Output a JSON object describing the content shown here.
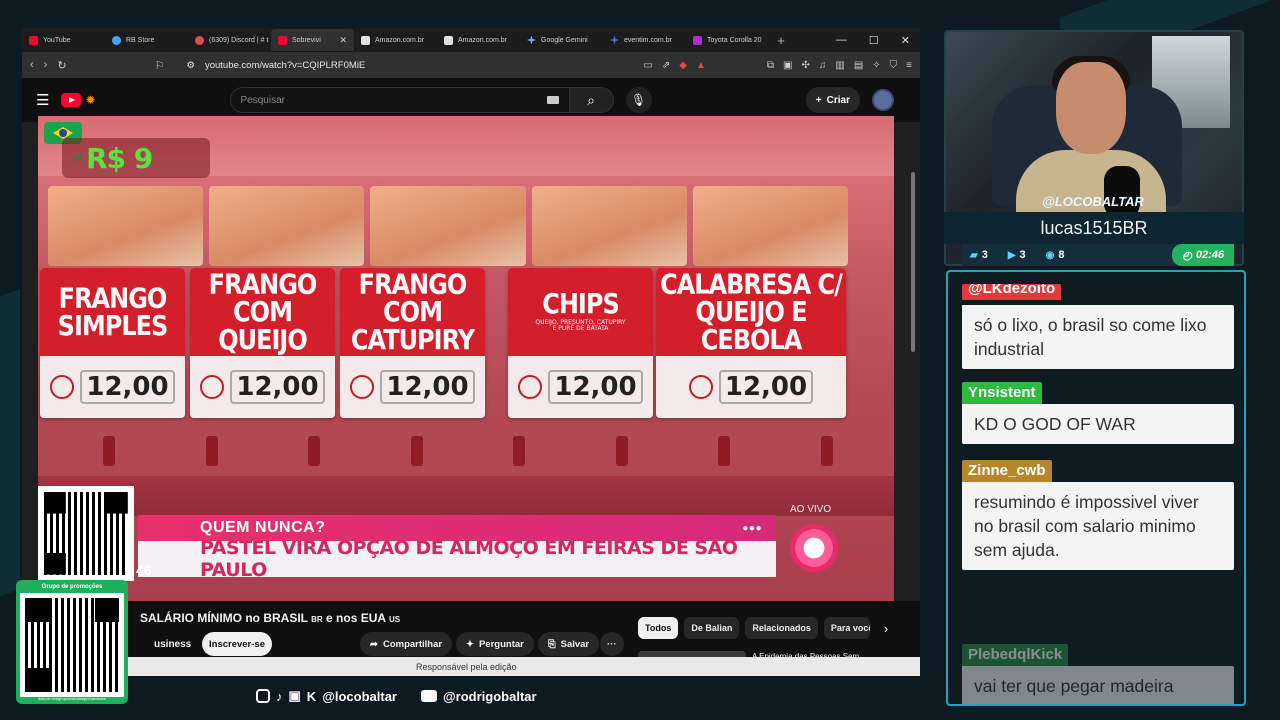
{
  "browser": {
    "tabs": [
      {
        "label": "YouTube",
        "color": "#ff0033"
      },
      {
        "label": "RB Store",
        "color": "#3da9f5"
      },
      {
        "label": "(6309) Discord | # t",
        "color": "#e14b52"
      },
      {
        "label": "Sobrevivi",
        "color": "#ff0033",
        "active": true
      },
      {
        "label": "Amazon.com.br",
        "color": "#e0e0e0"
      },
      {
        "label": "Amazon.com.br",
        "color": "#e0e0e0"
      },
      {
        "label": "Google Gemini",
        "color": "#7aa2ff"
      },
      {
        "label": "eventim.com.br",
        "color": "#5562e5"
      },
      {
        "label": "Toyota Corolla 20",
        "color": "#b12bd6"
      }
    ],
    "url": "youtube.com/watch?v=CQIPLRF0MiE"
  },
  "youtube": {
    "search_placeholder": "Pesquisar",
    "create_label": "Criar"
  },
  "video": {
    "price_tag_small": "MÍ",
    "price_tag": "R$ 9",
    "signs": [
      {
        "name": "FRANGO\nSIMPLES",
        "price": "12,00"
      },
      {
        "name": "FRANGO\nCOM QUEIJO",
        "price": "12,00"
      },
      {
        "name": "FRANGO COM\nCATUPIRY",
        "price": "12,00"
      },
      {
        "name": "CHIPS",
        "sub": "QUEIJO, PRESUNTO, CATUPIRY\nE PURÊ DE BATATA",
        "price": "12,00"
      },
      {
        "name": "CALABRESA C/\nQUEIJO E CEBOLA",
        "price": "12,00"
      }
    ],
    "news_top": "QUEM NUNCA?",
    "news_bottom": "PASTEL VIRA OPÇÃO DE ALMOÇO EM FEIRAS DE SÃO PAULO",
    "ao_vivo": "AO VIVO",
    "qr_label": "46"
  },
  "below_video": {
    "title": "SALÁRIO MÍNIMO no BRASIL",
    "title_flag1": "BR",
    "title_mid": "e nos EUA",
    "title_flag2": "US",
    "channel": "usiness",
    "subscribe": "Inscrever-se",
    "actions": [
      "Compartilhar",
      "Perguntar",
      "Salvar"
    ],
    "more": "···",
    "chips": [
      "Todos",
      "De Balian",
      "Relacionados",
      "Para você"
    ],
    "rec_title": "A Epidemia das Pessoas Sem",
    "edit_bar": "Responsável pela edição"
  },
  "promo": {
    "label": "Grupo de promoções",
    "url": "rbstore.net/grupos/whatsapp/hardware"
  },
  "social": {
    "handle1": "@locobaltar",
    "handle2": "@rodrigobaltar"
  },
  "webcam": {
    "handle": "@LOCOBALTAR",
    "user": "lucas1515BR",
    "stats": [
      "3",
      "3",
      "8"
    ],
    "timer": "02:46"
  },
  "chat": {
    "messages": [
      {
        "user": "@LKdezoito",
        "color": "#e03a3a",
        "text": "só o lixo, o brasil so come lixo industrial"
      },
      {
        "user": "Ynsistent",
        "color": "#2dbb3b",
        "text": "KD O GOD OF WAR"
      },
      {
        "user": "Zinne_cwb",
        "color": "#b8862a",
        "text": "resumindo é impossivel viver no brasil com salario minimo sem ajuda."
      },
      {
        "user": "PlebedqlKick",
        "color": "#2a8a48",
        "text": "vai ter que pegar madeira"
      }
    ]
  }
}
